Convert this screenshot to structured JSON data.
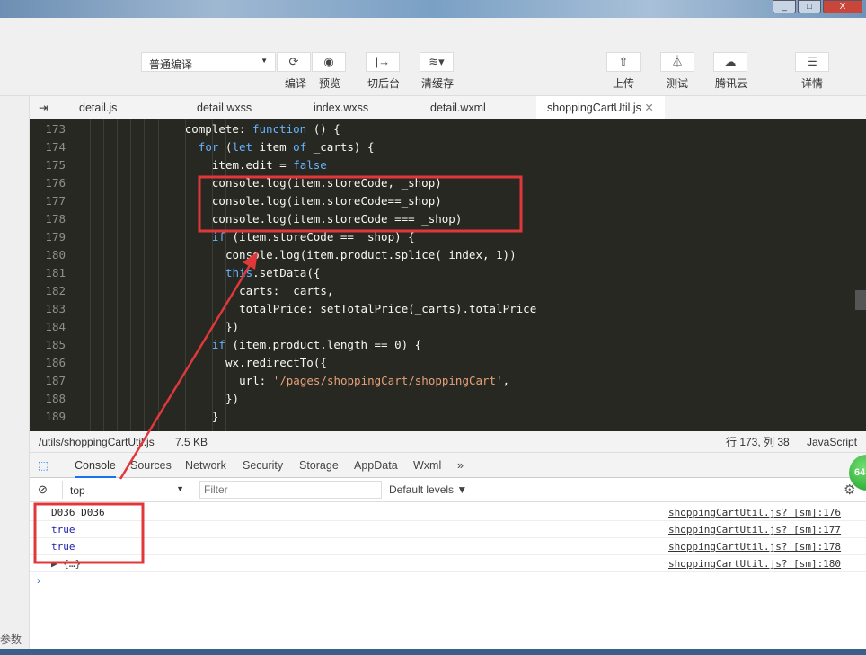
{
  "toolbar": {
    "compile_mode": "普通编译",
    "buttons": [
      {
        "icon": "refresh-icon",
        "label": "编译"
      },
      {
        "icon": "eye-icon",
        "label": "预览"
      },
      {
        "icon": "background-icon",
        "label": "切后台"
      },
      {
        "icon": "layers-icon",
        "label": "清缓存"
      },
      {
        "icon": "upload-icon",
        "label": "上传"
      },
      {
        "icon": "flask-icon",
        "label": "测试"
      },
      {
        "icon": "cloud-icon",
        "label": "腾讯云"
      },
      {
        "icon": "menu-icon",
        "label": "详情"
      }
    ]
  },
  "tabs": [
    {
      "label": "detail.js"
    },
    {
      "label": "detail.wxss"
    },
    {
      "label": "index.wxss"
    },
    {
      "label": "detail.wxml"
    },
    {
      "label": "shoppingCartUtil.js",
      "active": true
    }
  ],
  "code": [
    {
      "n": "173",
      "i": 14,
      "t": [
        [
          "pl",
          "complete: "
        ],
        [
          "kw",
          "function"
        ],
        [
          "pl",
          " () {"
        ]
      ]
    },
    {
      "n": "174",
      "i": 16,
      "t": [
        [
          "kw",
          "for"
        ],
        [
          "pl",
          " ("
        ],
        [
          "kw",
          "let"
        ],
        [
          "pl",
          " item "
        ],
        [
          "kw",
          "of"
        ],
        [
          "pl",
          " _carts) {"
        ]
      ]
    },
    {
      "n": "175",
      "i": 18,
      "t": [
        [
          "pl",
          "item.edit = "
        ],
        [
          "kw",
          "false"
        ]
      ]
    },
    {
      "n": "176",
      "i": 18,
      "t": [
        [
          "pl",
          "console.log(item.storeCode, _shop)"
        ]
      ]
    },
    {
      "n": "177",
      "i": 18,
      "t": [
        [
          "pl",
          "console.log(item.storeCode==_shop)"
        ]
      ]
    },
    {
      "n": "178",
      "i": 18,
      "t": [
        [
          "pl",
          "console.log(item.storeCode === _shop)"
        ]
      ]
    },
    {
      "n": "179",
      "i": 18,
      "t": [
        [
          "kw",
          "if"
        ],
        [
          "pl",
          " (item.storeCode == _shop) {"
        ]
      ]
    },
    {
      "n": "180",
      "i": 20,
      "t": [
        [
          "pl",
          "console.log(item.product.splice(_index, 1))"
        ]
      ]
    },
    {
      "n": "181",
      "i": 20,
      "t": [
        [
          "kw",
          "this"
        ],
        [
          "pl",
          ".setData({"
        ]
      ]
    },
    {
      "n": "182",
      "i": 22,
      "t": [
        [
          "pl",
          "carts: _carts,"
        ]
      ]
    },
    {
      "n": "183",
      "i": 22,
      "t": [
        [
          "pl",
          "totalPrice: setTotalPrice(_carts).totalPrice"
        ]
      ]
    },
    {
      "n": "184",
      "i": 20,
      "t": [
        [
          "pl",
          "})"
        ]
      ]
    },
    {
      "n": "185",
      "i": 18,
      "t": [
        [
          "kw",
          "if"
        ],
        [
          "pl",
          " (item.product.length == 0) {"
        ]
      ]
    },
    {
      "n": "186",
      "i": 20,
      "t": [
        [
          "pl",
          "wx.redirectTo({"
        ]
      ]
    },
    {
      "n": "187",
      "i": 22,
      "t": [
        [
          "pl",
          "url: "
        ],
        [
          "str",
          "'/pages/shoppingCart/shoppingCart'"
        ],
        [
          "pl",
          ","
        ]
      ]
    },
    {
      "n": "188",
      "i": 20,
      "t": [
        [
          "pl",
          "})"
        ]
      ]
    },
    {
      "n": "189",
      "i": 18,
      "t": [
        [
          "pl",
          "}"
        ]
      ]
    }
  ],
  "status": {
    "path": "/utils/shoppingCartUtil.js",
    "size": "7.5 KB",
    "position": "行 173, 列 38",
    "language": "JavaScript"
  },
  "devtools": {
    "tabs": [
      "Console",
      "Sources",
      "Network",
      "Security",
      "Storage",
      "AppData",
      "Wxml",
      "»"
    ],
    "context": "top",
    "filter_placeholder": "Filter",
    "levels": "Default levels ▼",
    "badge": "64"
  },
  "console": [
    {
      "msg": "D036 D036",
      "src": "shoppingCartUtil.js? [sm]:176",
      "color": "#222"
    },
    {
      "msg": "true",
      "src": "shoppingCartUtil.js? [sm]:177",
      "color": "#1a1aa6"
    },
    {
      "msg": "true",
      "src": "shoppingCartUtil.js? [sm]:178",
      "color": "#1a1aa6"
    },
    {
      "msg": "▶ {…}",
      "src": "shoppingCartUtil.js? [sm]:180",
      "color": "#444"
    }
  ],
  "left_strip_label": "参数",
  "annotation_color": "#e0383a"
}
